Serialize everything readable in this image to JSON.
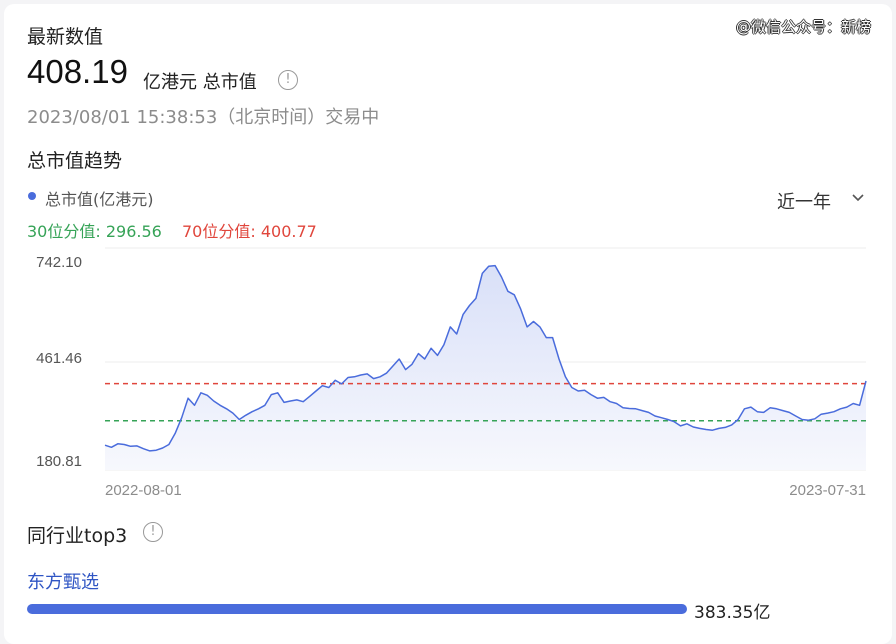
{
  "watermark": "@微信公众号：新榜",
  "latest": {
    "label": "最新数值",
    "value": "408.19",
    "unit": "亿港元 总市值",
    "info_glyph": "!",
    "timestamp": "2023/08/01 15:38:53（北京时间）交易中"
  },
  "trend": {
    "title": "总市值趋势",
    "legend": "总市值(亿港元)",
    "period": "近一年",
    "p30_label": "30位分值: 296.56",
    "p70_label": "70位分值: 400.77"
  },
  "peers": {
    "title": "同行业top3",
    "info_glyph": "!",
    "items": [
      {
        "name": "东方甄选",
        "value_label": "383.35亿",
        "fraction": 1.0
      }
    ]
  },
  "colors": {
    "line": "#4a6cdc",
    "p30": "#36a357",
    "p70": "#e0463c",
    "fill": "#e8ecfb"
  },
  "chart_data": {
    "type": "line",
    "title": "",
    "xlabel": "",
    "ylabel": "",
    "x_tick_labels": [
      "2022-08-01",
      "2023-07-31"
    ],
    "y_tick_labels": [
      "742.10",
      "461.46",
      "180.81"
    ],
    "ylim": [
      180.81,
      742.1
    ],
    "grid": true,
    "reference_lines": [
      {
        "name": "30位分值",
        "value": 296.56,
        "style": "dashed",
        "color": "#36a357"
      },
      {
        "name": "70位分值",
        "value": 400.77,
        "style": "dashed",
        "color": "#e0463c"
      }
    ],
    "series": [
      {
        "values": [
          228,
          222,
          232,
          230,
          225,
          226,
          218,
          212,
          214,
          220,
          230,
          262,
          305,
          360,
          340,
          375,
          368,
          352,
          340,
          330,
          318,
          300,
          312,
          322,
          330,
          340,
          370,
          375,
          348,
          352,
          355,
          350,
          365,
          380,
          395,
          390,
          410,
          400,
          418,
          420,
          425,
          428,
          415,
          420,
          430,
          450,
          470,
          440,
          455,
          485,
          470,
          500,
          480,
          510,
          560,
          540,
          595,
          620,
          640,
          710,
          730,
          732,
          700,
          660,
          650,
          610,
          560,
          575,
          560,
          530,
          530,
          470,
          420,
          390,
          380,
          382,
          370,
          360,
          362,
          350,
          345,
          333,
          331,
          330,
          325,
          320,
          310,
          305,
          300,
          294,
          282,
          288,
          279,
          275,
          272,
          270,
          275,
          278,
          285,
          300,
          330,
          335,
          322,
          320,
          333,
          330,
          325,
          320,
          310,
          300,
          298,
          302,
          315,
          318,
          322,
          330,
          335,
          345,
          340,
          408
        ]
      }
    ]
  }
}
